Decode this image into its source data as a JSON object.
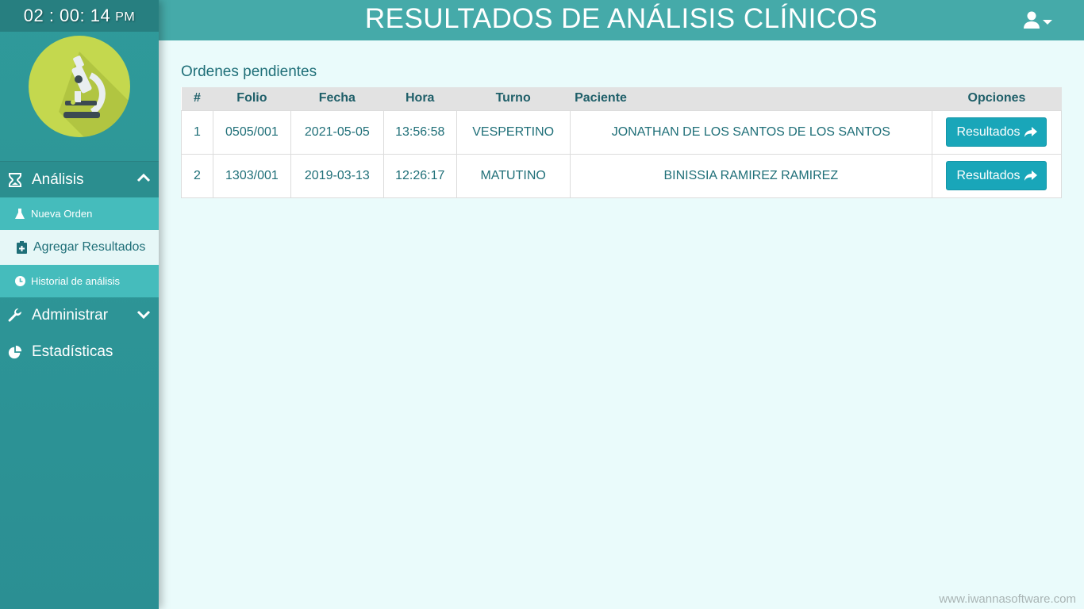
{
  "clock": {
    "time": "02 : 00: 14",
    "ampm": "PM"
  },
  "header": {
    "title": "RESULTADOS DE ANÁLISIS CLÍNICOS"
  },
  "sidebar": {
    "sections": {
      "analisis": {
        "label": "Análisis"
      },
      "administrar": {
        "label": "Administrar"
      },
      "estadisticas": {
        "label": "Estadísticas"
      }
    },
    "submenu": {
      "nueva_orden": "Nueva Orden",
      "agregar_resultados": "Agregar Resultados",
      "historial": "Historial de análisis"
    }
  },
  "main": {
    "section_title": "Ordenes pendientes",
    "columns": {
      "num": "#",
      "folio": "Folio",
      "fecha": "Fecha",
      "hora": "Hora",
      "turno": "Turno",
      "paciente": "Paciente",
      "opciones": "Opciones"
    },
    "rows": [
      {
        "num": "1",
        "folio": "0505/001",
        "fecha": "2021-05-05",
        "hora": "13:56:58",
        "turno": "VESPERTINO",
        "paciente": "JONATHAN DE LOS SANTOS DE LOS SANTOS",
        "button": "Resultados"
      },
      {
        "num": "2",
        "folio": "1303/001",
        "fecha": "2019-03-13",
        "hora": "12:26:17",
        "turno": "MATUTINO",
        "paciente": "BINISSIA RAMIREZ RAMIREZ",
        "button": "Resultados"
      }
    ]
  },
  "footer": {
    "watermark": "www.iwannasoftware.com"
  },
  "colors": {
    "sidebar": "#2f9a9a",
    "header": "#45aaa9",
    "submenu": "#45bcbc",
    "button": "#19a6b9",
    "background": "#eafbfb",
    "logo": "#c4d84e"
  },
  "icons": {
    "analisis": "hourglass-icon",
    "administrar": "wrench-icon",
    "estadisticas": "pie-chart-icon",
    "nueva_orden": "flask-icon",
    "agregar_resultados": "medical-clipboard-icon",
    "historial": "clock-icon",
    "user": "user-icon",
    "button": "share-arrow-icon",
    "logo": "microscope-icon"
  }
}
